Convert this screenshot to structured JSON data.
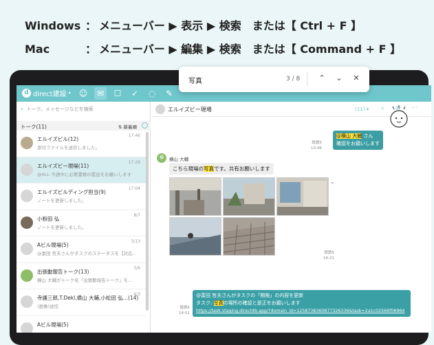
{
  "instructions": {
    "windows_label": "Windows",
    "windows_colon": "：",
    "windows_path": "メニューバー ▶ 表示 ▶ 検索　または【 Ctrl + F 】",
    "mac_label": "Mac",
    "mac_colon": "：",
    "mac_path": "メニューバー ▶ 編集 ▶ 検索　または【 Command + F 】"
  },
  "find_bar": {
    "query": "写真",
    "count": "3 / 8",
    "up_icon": "chevron-up-icon",
    "down_icon": "chevron-down-icon",
    "close_icon": "close-icon"
  },
  "topbar": {
    "workspace": "direct建設",
    "icons": [
      "contacts-icon",
      "talk-icon",
      "task-icon",
      "check-icon",
      "chat-bubbles-icon",
      "tools-icon"
    ]
  },
  "sidebar": {
    "search_placeholder": "トーク、メッセージなどを検索",
    "talk_header": "トーク(11)",
    "sort_label": "新着順",
    "items": [
      {
        "name": "エルイズビル(12)",
        "preview": "添付ファイルを送信しました。",
        "time": "17:46"
      },
      {
        "name": "エルイズビー現場(11)",
        "preview": "@ALL 今週中に必要書類の提出をお願いします",
        "time": "17:29"
      },
      {
        "name": "エルイズビルディング担当(9)",
        "preview": "ノートを更新しました。",
        "time": "17:04"
      },
      {
        "name": "小粉田 弘",
        "preview": "ノートを更新しました。",
        "time": "8/7"
      },
      {
        "name": "Aビル現場(5)",
        "preview": "@富田 哲夫さんがタスクのステータスを【対応...",
        "time": "3/13"
      },
      {
        "name": "出張動報告トーク(13)",
        "preview": "横山 大輔がトーク名「出張動報告トーク」を...",
        "time": "3/9"
      },
      {
        "name": "寺護三郎,T.Dekl,横山 大輔,小松田 弘...(14)",
        "preview": "(画像)送信",
        "time": "4/3"
      },
      {
        "name": "Aビル現場(5)",
        "preview": "",
        "time": ""
      }
    ]
  },
  "chat": {
    "title": "エルイズビー現場",
    "member_count": "(11)",
    "msg1_line1_prefix": "@横山 大輔",
    "msg1_line1_suffix": " さん",
    "msg1_line2": "確認をお願いします",
    "msg1_read": "既読5",
    "msg1_time": "13:46",
    "sender_initial": "横",
    "sender_name": "横山 大輔",
    "msg2_before": "こちら現場の",
    "msg2_highlight": "写真",
    "msg2_after": "です。共有お願いします",
    "photos_read": "既読5",
    "photos_time": "14:21",
    "msg3_line1": "@富田 哲夫さんがタスクの「期限」の内容を更新",
    "msg3_line2_before": "タスク: ",
    "msg3_line2_highlight": "写真",
    "msg3_line2_after": "の場所の確認と是正をお願いします",
    "msg3_link": "https://task.staging.direct4b.app/?domain_id=1258738360877326336&task=2a1c02566f06964",
    "msg3_read": "既読5",
    "msg3_time": "14:51"
  }
}
